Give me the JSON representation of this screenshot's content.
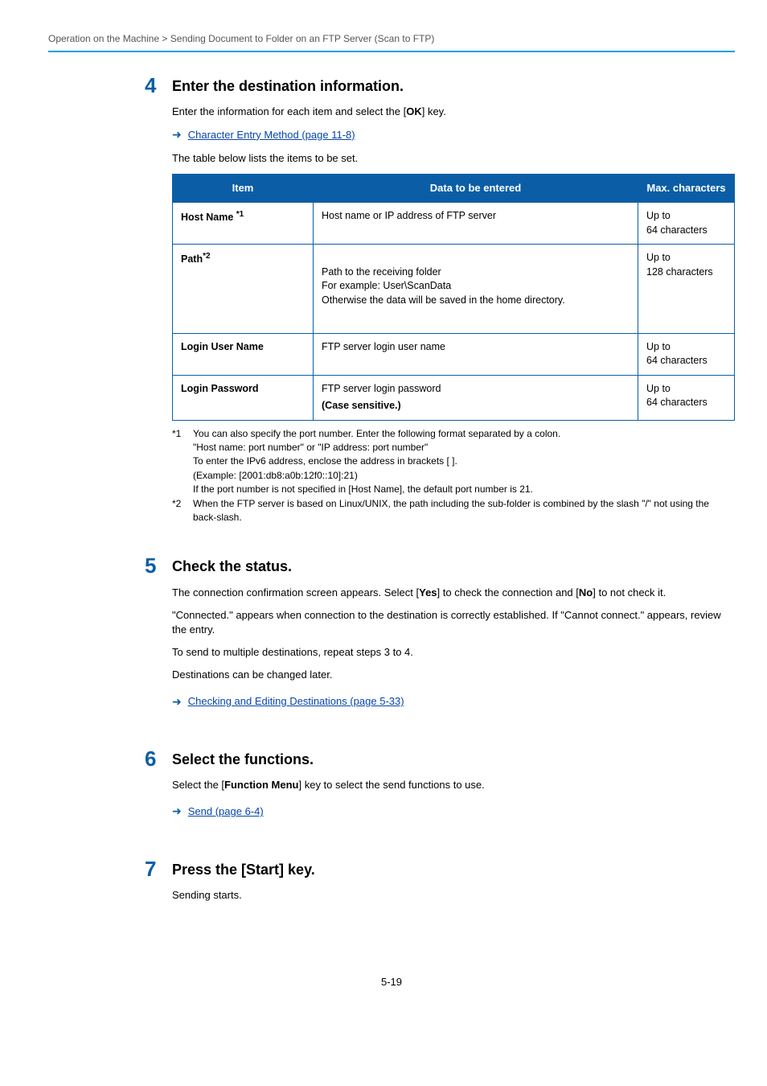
{
  "breadcrumb": "Operation on the Machine > Sending Document to Folder on an FTP Server (Scan to FTP)",
  "steps": {
    "s4": {
      "num": "4",
      "title": "Enter the destination information.",
      "intro_before": "Enter the information for each item and select the [",
      "intro_bold": "OK",
      "intro_after": "] key.",
      "link": "Character Entry Method (page 11-8)",
      "note": "The table below lists the items to be set.",
      "table": {
        "headers": {
          "c1": "Item",
          "c2": "Data to be entered",
          "c3": "Max. characters"
        },
        "rows": [
          {
            "item": "Host Name ",
            "sup": "*1",
            "data": "Host name or IP address of FTP server",
            "max": "Up to\n64 characters"
          },
          {
            "item": "Path",
            "sup": "*2",
            "data": "Path to the receiving folder\nFor example: User\\ScanData\nOtherwise the data will be saved in the home directory.",
            "max": "Up to\n128 characters"
          },
          {
            "item": "Login User Name",
            "sup": "",
            "data": "FTP server login user name",
            "max": "Up to\n64 characters"
          },
          {
            "item": "Login Password",
            "sup": "",
            "data": "FTP server login password",
            "data_bold": "(Case sensitive.)",
            "max": "Up to\n64 characters"
          }
        ]
      },
      "footnotes": {
        "f1n": "*1",
        "f1t": "You can also specify the port number. Enter the following format separated by a colon.\n\"Host name: port number\" or \"IP address: port number\"\nTo enter the IPv6 address, enclose the address in brackets [ ].\n(Example: [2001:db8:a0b:12f0::10]:21)\nIf the port number is not specified in [Host Name], the default port number is 21.",
        "f2n": "*2",
        "f2t": "When the FTP server is based on Linux/UNIX, the path including the sub-folder is combined by the slash \"/\" not using the back-slash."
      }
    },
    "s5": {
      "num": "5",
      "title": "Check the status.",
      "p1a": "The connection confirmation screen appears. Select [",
      "p1b": "Yes",
      "p1c": "] to check the connection and [",
      "p1d": "No",
      "p1e": "] to not check it.",
      "p2": "\"Connected.\" appears when connection to the destination is correctly established. If \"Cannot connect.\" appears, review the entry.",
      "p3": "To send to multiple destinations, repeat steps 3 to 4.",
      "p4": "Destinations can be changed later.",
      "link": "Checking and Editing Destinations (page 5-33)"
    },
    "s6": {
      "num": "6",
      "title": "Select the functions.",
      "p1a": "Select the [",
      "p1b": "Function Menu",
      "p1c": "] key to select the send functions to use.",
      "link": "Send (page 6-4)"
    },
    "s7": {
      "num": "7",
      "title": "Press the [Start] key.",
      "p1": "Sending starts."
    }
  },
  "pageno": "5-19"
}
